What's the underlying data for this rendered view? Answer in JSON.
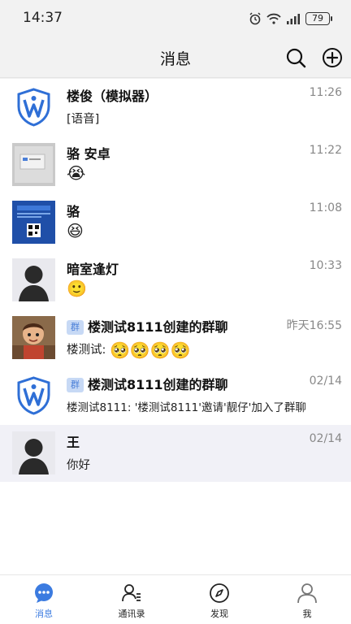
{
  "status_bar": {
    "time": "14:37",
    "battery": "79"
  },
  "header": {
    "title": "消息"
  },
  "messages": [
    {
      "name": "楼俊（模拟器）",
      "time": "11:26",
      "preview": "[语音]"
    },
    {
      "name": "骆 安卓",
      "time": "11:22",
      "preview": "😭"
    },
    {
      "name": "骆",
      "time": "11:08",
      "preview": "😆"
    },
    {
      "name": "暗室逢灯",
      "time": "10:33",
      "preview": "🙂"
    },
    {
      "tag": "群",
      "name": "楼测试8111创建的群聊",
      "time": "昨天16:55",
      "preview": "楼测试:",
      "emojis": "🥺🥺🥺🥺"
    },
    {
      "tag": "群",
      "name": "楼测试8111创建的群聊",
      "time": "02/14",
      "preview": "楼测试8111: '楼测试8111'邀请'靓仔'加入了群聊"
    },
    {
      "name": "王",
      "time": "02/14",
      "preview": "你好"
    }
  ],
  "tabs": [
    {
      "label": "消息"
    },
    {
      "label": "通讯录"
    },
    {
      "label": "发现"
    },
    {
      "label": "我"
    }
  ],
  "colors": {
    "accent": "#3b7be0",
    "tag_bg": "#c7d9f5",
    "shield": "#2f6fd6"
  }
}
